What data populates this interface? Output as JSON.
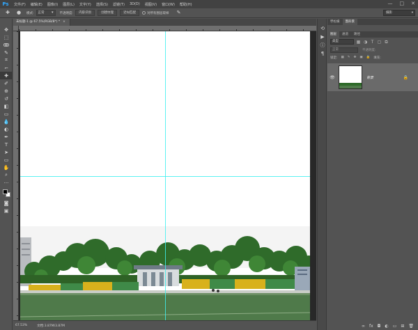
{
  "app": {
    "logo": "Ps"
  },
  "menu": [
    "文件(F)",
    "编辑(E)",
    "图像(I)",
    "图层(L)",
    "文字(Y)",
    "选择(S)",
    "滤镜(T)",
    "3D(D)",
    "视图(V)",
    "窗口(W)",
    "帮助(H)"
  ],
  "window_controls": [
    "—",
    "□",
    "✕"
  ],
  "options": {
    "mode_label": "模式:",
    "mode_value": "正常",
    "opacity_label": "不透明度:",
    "btn_content_aware": "内容识别",
    "btn_create_texture": "创建纹理",
    "btn_proximity": "近似匹配",
    "sample_all_layers": "对所有图层取样",
    "workspace": "摄影"
  },
  "tools": [
    "move-icon",
    "marquee-icon",
    "lasso-icon",
    "quick-select-icon",
    "crop-icon",
    "eyedropper-icon",
    "healing-icon",
    "brush-icon",
    "stamp-icon",
    "history-brush-icon",
    "eraser-icon",
    "gradient-icon",
    "blur-icon",
    "dodge-icon",
    "pen-icon",
    "type-icon",
    "path-select-icon",
    "rectangle-icon",
    "hand-icon",
    "zoom-icon",
    "more-icon"
  ],
  "tool_glyphs": [
    "✥",
    "⬚",
    "ↂ",
    "✎",
    "⌗",
    "⌐",
    "✚",
    "✐",
    "⊕",
    "↺",
    "◧",
    "▭",
    "💧",
    "◐",
    "✒",
    "T",
    "➤",
    "▭",
    "✋",
    "⌕",
    "···"
  ],
  "document": {
    "tab_title": "未标题-1 @ 67.5%(RGB/8*) *",
    "close_glyph": "×",
    "zoom": "67.53%",
    "doc_info": "文档:3.87M/3.87M"
  },
  "colors": {
    "foreground": "#000000",
    "background": "#ffffff",
    "guide": "#3ff0f0"
  },
  "panels": {
    "top_tabs": [
      "學松橫",
      "蓋形景"
    ],
    "layer_tabs": [
      "图层",
      "通道",
      "路径"
    ],
    "filter_kind": "类型",
    "blend_mode": "正常",
    "opacity_label": "不透明度:",
    "lock_label": "锁定:",
    "fill_label": "填充:",
    "layer_name": "背景",
    "lock_glyph": "🔒",
    "eye_glyph": "👁"
  },
  "right_strip": [
    "history-icon",
    "play-icon",
    "info-icon",
    "paragraph-icon"
  ]
}
